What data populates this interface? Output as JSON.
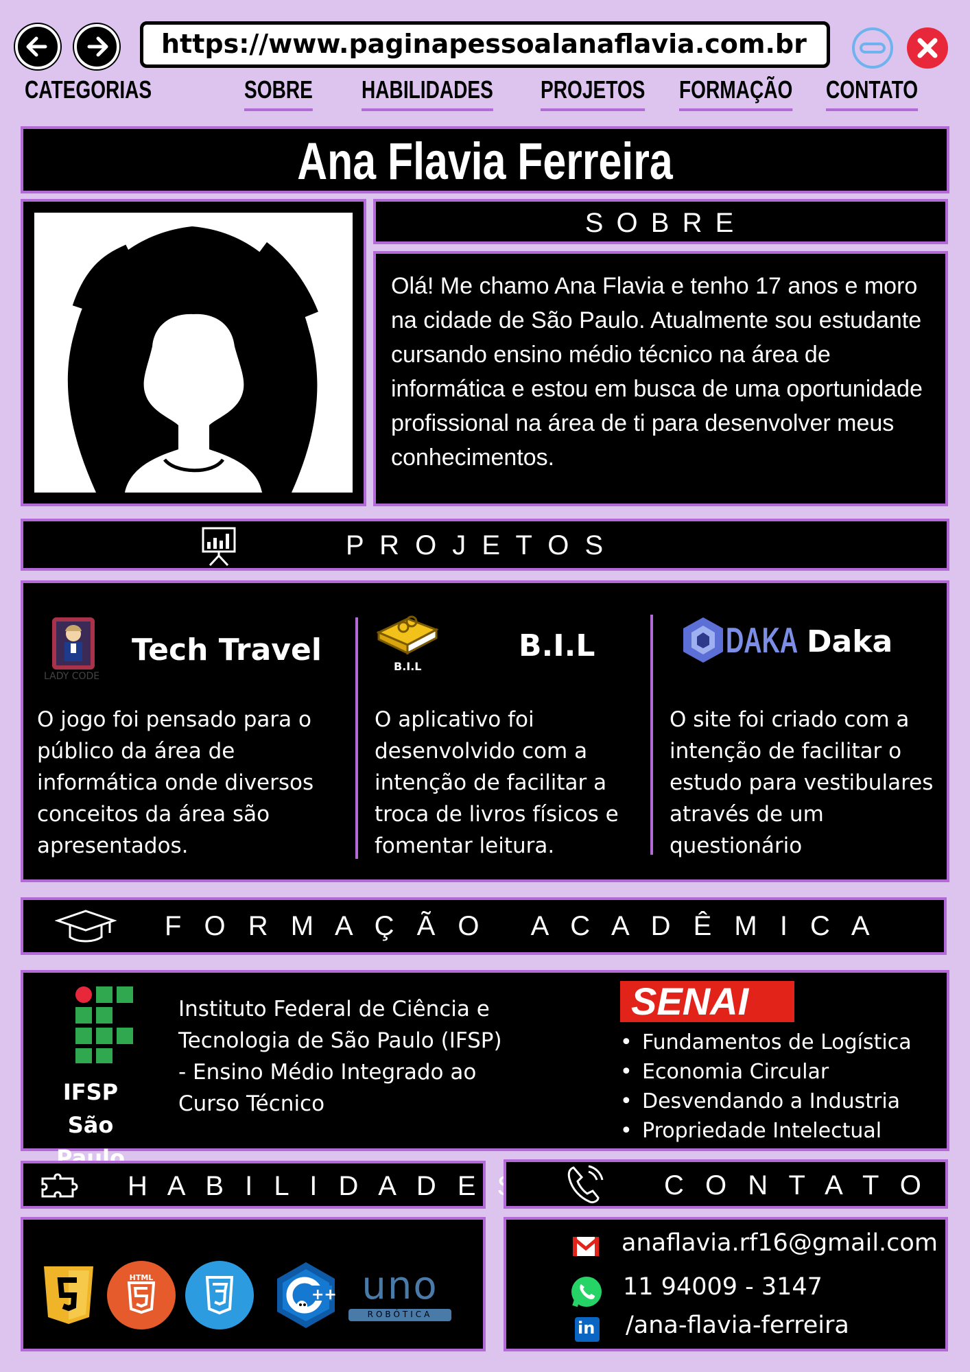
{
  "browser": {
    "url": "https://www.paginapessoalanaflavia.com.br",
    "back_icon": "arrow-left-icon",
    "forward_icon": "arrow-right-icon",
    "minimize_icon": "minimize-icon",
    "close_icon": "close-icon"
  },
  "nav": {
    "categories_label": "CATEGORIAS",
    "items": [
      {
        "label": "SOBRE"
      },
      {
        "label": "HABILIDADES"
      },
      {
        "label": "PROJETOS"
      },
      {
        "label": "FORMAÇÃO"
      },
      {
        "label": "CONTATO"
      }
    ]
  },
  "profile": {
    "name": "Ana Flavia Ferreira",
    "avatar_icon": "avatar-silhouette-icon"
  },
  "about": {
    "heading": "S O B R E",
    "text": "Olá! Me chamo Ana Flavia e tenho 17 anos e moro na cidade de São Paulo. Atualmente sou estudante cursando ensino médio técnico na área de informática e estou em busca de uma oportunidade profissional na área de ti para desenvolver meus conhecimentos."
  },
  "projects": {
    "heading": "P R O J E T O S",
    "heading_icon": "presentation-chart-icon",
    "items": [
      {
        "title": "Tech Travel",
        "logo_caption": "LADY CODE",
        "logo_icon": "lady-code-logo-icon",
        "description": "O jogo foi pensado para o público da área de informática onde diversos conceitos da área são apresentados."
      },
      {
        "title": "B.I.L",
        "logo_caption": "B.I.L",
        "logo_icon": "book-logo-icon",
        "description": "O aplicativo foi desenvolvido com a intenção de facilitar a troca de livros físicos e fomentar leitura."
      },
      {
        "title": "Daka",
        "logo_caption": "DAKA",
        "logo_icon": "daka-logo-icon",
        "description": "O site foi criado com a intenção de facilitar o estudo para vestibulares através de um questionário"
      }
    ]
  },
  "education": {
    "heading": "F O R M A Ç Ã O   A C A D Ê M I C A",
    "heading_icon": "graduation-cap-icon",
    "ifsp_logo_line1": "IFSP",
    "ifsp_logo_line2": "São Paulo",
    "ifsp_text": "Instituto Federal de Ciência e Tecnologia de São Paulo (IFSP) - Ensino Médio Integrado ao Curso Técnico",
    "senai_logo": "SENAI",
    "senai_courses": [
      "Fundamentos de Logística",
      "Economia Circular",
      "Desvendando a Industria",
      "Propriedade Intelectual"
    ]
  },
  "skills": {
    "heading": "H A B I L I D A D E S",
    "heading_icon": "puzzle-icon",
    "icons": [
      "javascript-icon",
      "html5-icon",
      "css3-icon",
      "cplusplus-icon",
      "uno-robotica-icon"
    ],
    "html_badge": "HTML",
    "uno_text": "uno",
    "uno_sub": "ROBÓTICA"
  },
  "contact": {
    "heading": "C O N T A T O",
    "heading_icon": "phone-icon",
    "email": "anaflavia.rf16@gmail.com",
    "phone": "11 94009 - 3147",
    "linkedin": "/ana-flavia-ferreira",
    "linkedin_badge": "in"
  },
  "colors": {
    "background": "#dcc4ef",
    "accent": "#b36ad6",
    "panel": "#000000",
    "close": "#e8283a",
    "minimize": "#6fb3ee",
    "senai": "#e2231a"
  }
}
